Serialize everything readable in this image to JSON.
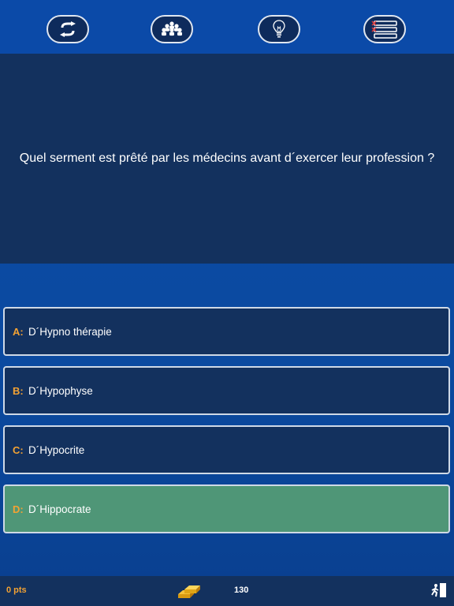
{
  "toolbar": {
    "buttons": [
      {
        "icon": "swap-arrows-icon"
      },
      {
        "icon": "audience-icon"
      },
      {
        "icon": "lightbulb-icon"
      },
      {
        "icon": "fifty-fifty-list-icon"
      }
    ]
  },
  "question": {
    "text": "Quel serment est prêté par les médecins avant d´exercer leur profession ?"
  },
  "answers": [
    {
      "letter": "A:",
      "text": "D´Hypno thérapie",
      "state": "default"
    },
    {
      "letter": "B:",
      "text": "D´Hypophyse",
      "state": "default"
    },
    {
      "letter": "C:",
      "text": "D´Hypocrite",
      "state": "default"
    },
    {
      "letter": "D:",
      "text": "D´Hippocrate",
      "state": "correct"
    }
  ],
  "footer": {
    "score": "0 pts",
    "coins": "130",
    "gold_icon": "gold-bars-icon",
    "exit_icon": "exit-door-icon"
  },
  "colors": {
    "background": "#0b4aa0",
    "panel": "#13315e",
    "correct": "#4f9677",
    "accent": "#f3a233"
  }
}
